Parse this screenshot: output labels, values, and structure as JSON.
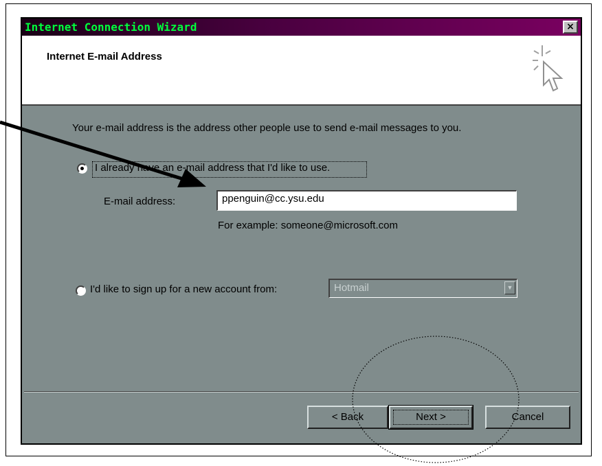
{
  "window": {
    "title": "Internet Connection Wizard",
    "close_label": "×"
  },
  "header": {
    "title": "Internet E-mail Address",
    "icon": "wizard-cursor-icon"
  },
  "body": {
    "intro": "Your e-mail address is the address other people use to send e-mail messages to you.",
    "option_existing": {
      "label": "I already have an e-mail address that I'd like to use.",
      "selected": true
    },
    "email_field": {
      "label": "E-mail address:",
      "value": "ppenguin@cc.ysu.edu",
      "example": "For example: someone@microsoft.com"
    },
    "option_new": {
      "label": "I'd like to sign up for a new account from:",
      "selected": false,
      "provider": "Hotmail"
    }
  },
  "buttons": {
    "back": "< Back",
    "next": "Next >",
    "cancel": "Cancel"
  }
}
